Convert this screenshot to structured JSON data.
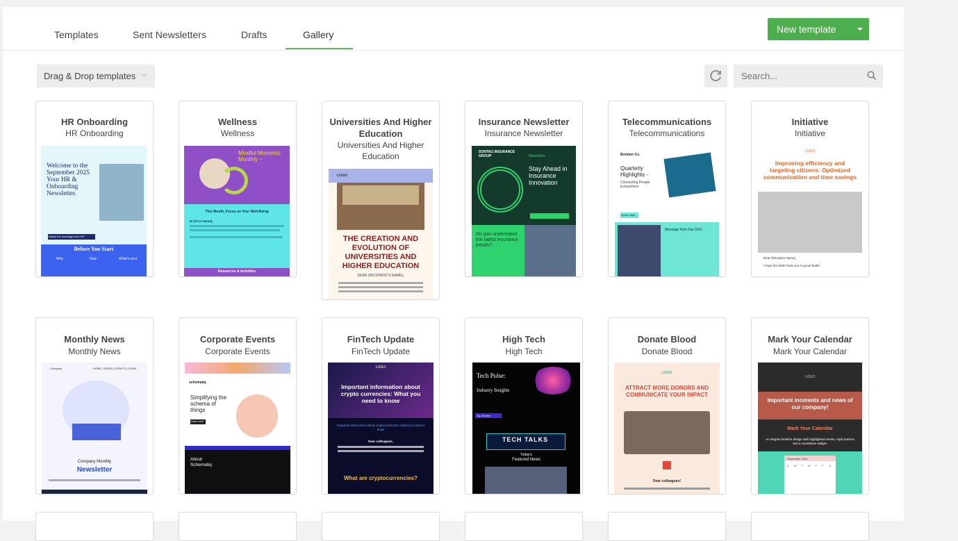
{
  "tabs": [
    {
      "label": "Templates",
      "active": false
    },
    {
      "label": "Sent Newsletters",
      "active": false
    },
    {
      "label": "Drafts",
      "active": false
    },
    {
      "label": "Gallery",
      "active": true
    }
  ],
  "new_template": {
    "label": "New template"
  },
  "toolbar": {
    "dropdown_label": "Drag & Drop templates",
    "search_placeholder": "Search...",
    "refresh_icon": "refresh-icon",
    "search_icon": "search-icon"
  },
  "colors": {
    "accent": "#4cae4c",
    "tab_underline": "#5cb85c"
  },
  "templates": [
    {
      "title": "HR Onboarding",
      "subtitle": "HR Onboarding",
      "thumb": {
        "heading": "Welcome to the September 2025 Your HR & Onboarding Newsletter.",
        "section": "Before You Start",
        "cols": [
          "Why",
          "How",
          "What's next"
        ],
        "button": "Watch the message from HR"
      }
    },
    {
      "title": "Wellness",
      "subtitle": "Wellness",
      "thumb": {
        "heading": "Mindful Moments Monthly ~",
        "focus": "This Month, Focus on Your Well-Being",
        "greeting": "Hi {First Name},",
        "footer": "Resources & Activities"
      }
    },
    {
      "title": "Universities And Higher Education",
      "subtitle": "Universities And Higher Education",
      "thumb": {
        "logo": "LOGO",
        "heading": "THE CREATION AND EVOLUTION OF UNIVERSITIES AND HIGHER EDUCATION",
        "greeting": "DEAR {RECIPIENT'S NAME},"
      }
    },
    {
      "title": "Insurance Newsletter",
      "subtitle": "Insurance Newsletter",
      "thumb": {
        "brand": "SONTAG INSURANCE GROUP",
        "kicker": "Newsletter",
        "heading": "Stay Ahead in Insurance Innovation",
        "question": "Do you understand the latest insurance trends?"
      }
    },
    {
      "title": "Telecommunications",
      "subtitle": "Telecommunications",
      "thumb": {
        "brand": "Brimton Co.",
        "heading": "Quarterly Highlights -",
        "sub": "Connecting People Everywhere",
        "message": "Message from Our CEO",
        "button": "Learn more"
      }
    },
    {
      "title": "Initiative",
      "subtitle": "Initiative",
      "thumb": {
        "logo": "LOGO",
        "heading": "Improving efficiency and targeting citizens: Optimized communication and time savings",
        "greeting": "Dear {Recipient Name},",
        "line": "I hope this letter finds you in good health."
      }
    },
    {
      "title": "Monthly News",
      "subtitle": "Monthly News",
      "thumb": {
        "brand": "Company",
        "nav": "HOME | NEWS | EVENTS | LOGIN",
        "kicker": "Company Monthly",
        "heading": "Newsletter"
      }
    },
    {
      "title": "Corporate Events",
      "subtitle": "Corporate Events",
      "thumb": {
        "brand": "schematiq",
        "heading": "Simplifying the schema of things",
        "button": "Learn more",
        "about": "About Schematiq"
      }
    },
    {
      "title": "FinTech Update",
      "subtitle": "FinTech Update",
      "thumb": {
        "logo": "LOGO",
        "heading": "Important information about crypto currencies: What you need to know",
        "sub": "Important information about cryptocurrencies: What you need to know",
        "greeting": "Dear colleagues,",
        "question": "What are cryptocurrencies?"
      }
    },
    {
      "title": "High Tech",
      "subtitle": "High Tech",
      "thumb": {
        "heading": "Tech Pulse:",
        "sub": "Industry Insights",
        "tag": "Top Stories",
        "banner": "TECH TALKS",
        "today": "Today's",
        "featured": "Featured News"
      }
    },
    {
      "title": "Donate Blood",
      "subtitle": "Donate Blood",
      "thumb": {
        "logo": "LOGO",
        "heading": "ATTRACT MORE DONORS AND COMMUNICATE YOUR IMPACT",
        "greeting": "Dear colleagues!"
      }
    },
    {
      "title": "Mark Your Calendar",
      "subtitle": "Mark Your Calendar",
      "thumb": {
        "logo": "LOGO",
        "heading": "Important moments and news of our company!",
        "sub": "Mark Your Calendar",
        "desc": "An elegant timeline design with highlighted events, reply buttons and a countdown widget.",
        "month": "September 2024",
        "days": [
          "S",
          "M",
          "T",
          "W",
          "T",
          "F",
          "S"
        ]
      }
    }
  ]
}
